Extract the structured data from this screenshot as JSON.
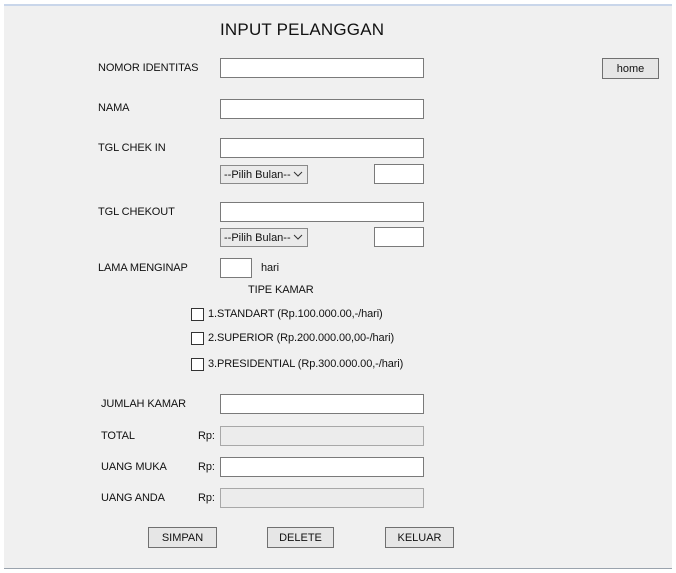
{
  "form": {
    "title": "INPUT PELANGGAN",
    "home_label": "home"
  },
  "fields": {
    "nomor_identitas": {
      "label": "NOMOR IDENTITAS",
      "value": ""
    },
    "nama": {
      "label": "NAMA",
      "value": ""
    },
    "tgl_checkin": {
      "label": "TGL CHEK IN",
      "value": "",
      "month_selected": "--Pilih Bulan--",
      "year_value": ""
    },
    "tgl_checkout": {
      "label": "TGL CHEKOUT",
      "value": "",
      "month_selected": "--Pilih Bulan--",
      "year_value": ""
    },
    "lama_menginap": {
      "label": "LAMA MENGINAP",
      "value": "",
      "unit": "hari"
    }
  },
  "room_type": {
    "heading": "TIPE KAMAR",
    "options": [
      {
        "label": "1.STANDART (Rp.100.000.00,-/hari)",
        "checked": false
      },
      {
        "label": "2.SUPERIOR (Rp.200.000.00,00-/hari)",
        "checked": false
      },
      {
        "label": "3.PRESIDENTIAL (Rp.300.000.00,-/hari)",
        "checked": false
      }
    ]
  },
  "payment": {
    "jumlah_kamar": {
      "label": "JUMLAH KAMAR",
      "value": ""
    },
    "total": {
      "label": "TOTAL",
      "prefix": "Rp:",
      "value": ""
    },
    "uang_muka": {
      "label": "UANG MUKA",
      "prefix": "Rp:",
      "value": ""
    },
    "uang_anda": {
      "label": "UANG ANDA",
      "prefix": "Rp:",
      "value": ""
    }
  },
  "actions": {
    "simpan": "SIMPAN",
    "delete": "DELETE",
    "keluar": "KELUAR"
  }
}
